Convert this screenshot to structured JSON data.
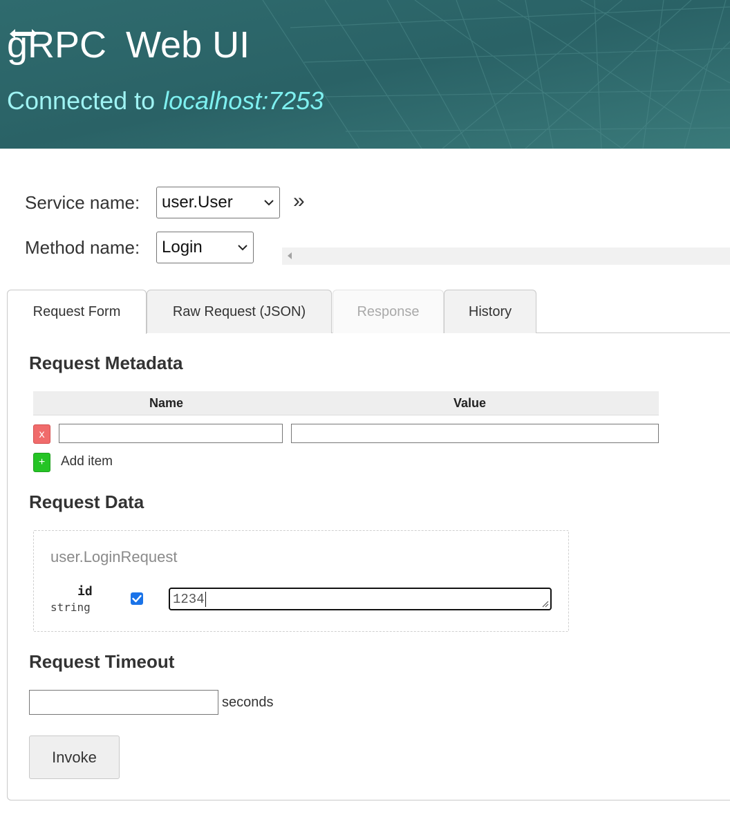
{
  "header": {
    "logo_text": "gRPC",
    "title": "Web UI",
    "connected_label": "Connected to",
    "host": "localhost:7253",
    "colors": {
      "background": "#2a6468",
      "text": "#ffffff",
      "host": "#7ef0f0"
    },
    "logo_icon": "double-arrow-icon"
  },
  "selectors": {
    "service_label": "Service name:",
    "service_value": "user.User",
    "method_label": "Method name:",
    "method_value": "Login",
    "expand_glyph": "»"
  },
  "tabs": [
    {
      "label": "Request Form",
      "state": "active"
    },
    {
      "label": "Raw Request (JSON)",
      "state": "normal"
    },
    {
      "label": "Response",
      "state": "disabled"
    },
    {
      "label": "History",
      "state": "normal"
    }
  ],
  "metadata": {
    "heading": "Request Metadata",
    "columns": [
      "Name",
      "Value"
    ],
    "rows": [
      {
        "name": "",
        "value": ""
      }
    ],
    "remove_label": "x",
    "add_icon": "+",
    "add_label": "Add item"
  },
  "request_data": {
    "heading": "Request Data",
    "message_type": "user.LoginRequest",
    "fields": [
      {
        "name": "id",
        "type": "string",
        "enabled": true,
        "value": "1234"
      }
    ]
  },
  "timeout": {
    "heading": "Request Timeout",
    "value": "",
    "unit": "seconds"
  },
  "invoke_label": "Invoke"
}
